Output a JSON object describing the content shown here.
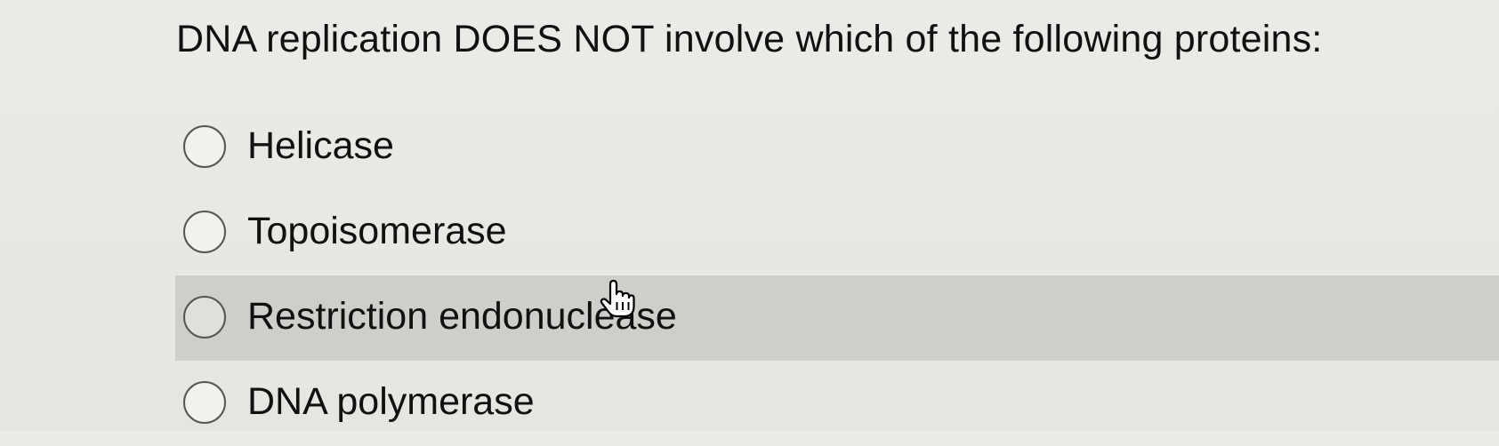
{
  "question": {
    "text": "DNA replication DOES NOT involve which of the following proteins:"
  },
  "options": [
    {
      "label": "Helicase",
      "selected": false,
      "hovered": false
    },
    {
      "label": "Topoisomerase",
      "selected": false,
      "hovered": false
    },
    {
      "label": "Restriction endonuclease",
      "selected": false,
      "hovered": true
    },
    {
      "label": "DNA polymerase",
      "selected": false,
      "hovered": false
    }
  ],
  "cursor": {
    "icon": "hand-pointer-icon"
  },
  "colors": {
    "background": "#ebeae7",
    "hover_band": "#cfcecb",
    "text": "#111111",
    "radio_border": "#555555"
  }
}
